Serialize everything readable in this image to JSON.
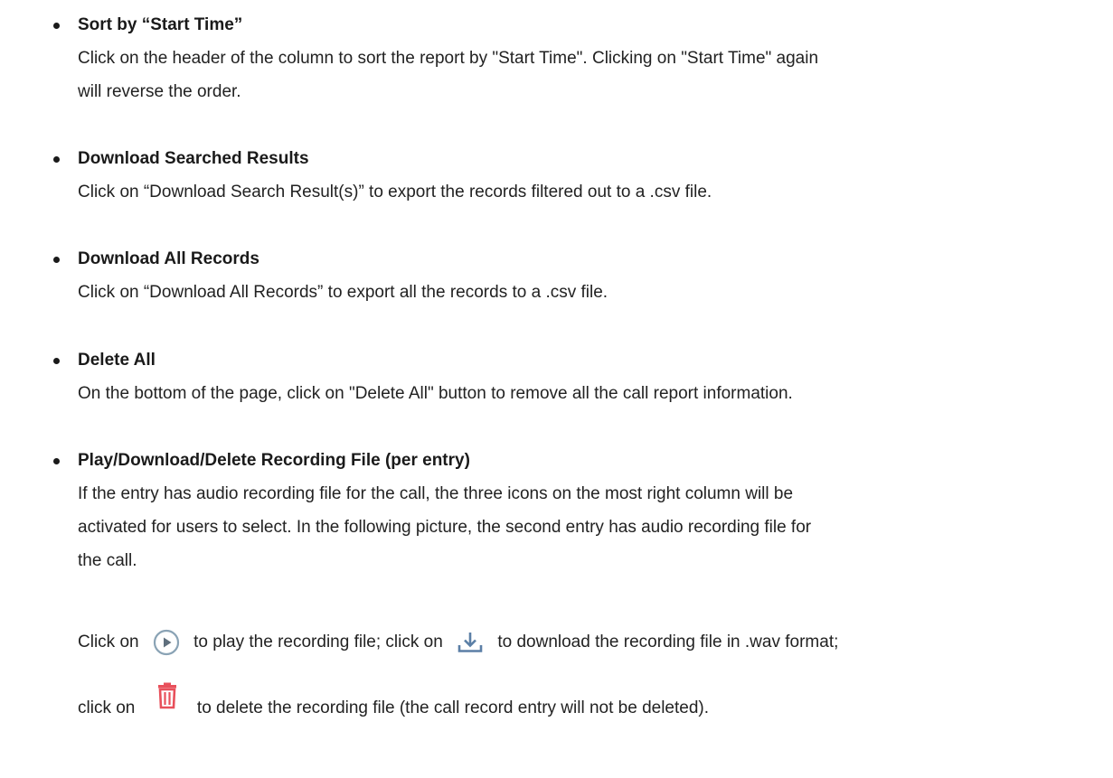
{
  "sections": [
    {
      "title": "Sort by “Start Time”",
      "lines": [
        "Click on the header of the column to sort the report by \"Start Time\". Clicking on \"Start Time\" again",
        "will reverse the order."
      ]
    },
    {
      "title": "Download Searched Results",
      "lines": [
        "Click on “Download Search Result(s)” to export the records filtered out to a .csv file."
      ]
    },
    {
      "title": "Download All Records",
      "lines": [
        "Click on “Download All Records” to export all the records to a .csv file."
      ]
    },
    {
      "title": "Delete All",
      "lines": [
        "On the bottom of the page, click on \"Delete All\" button to remove all the call report information."
      ]
    },
    {
      "title": "Play/Download/Delete Recording File (per entry)",
      "lines": [
        "If the entry has audio recording file for the call, the three icons on the most right column will be",
        "activated for users to select. In the following picture, the second entry has audio recording file for",
        "the call."
      ],
      "icon_sentence": {
        "line1": {
          "before_play": "Click on",
          "after_play": "to play the recording file; click on",
          "after_download": "to download the recording file in .wav format;"
        },
        "line2": {
          "before_delete": "click on",
          "after_delete": "to delete the recording file (the call record entry will not be deleted)."
        }
      }
    }
  ],
  "icons": {
    "play": "play-circle-icon",
    "download": "download-icon",
    "delete": "trash-icon"
  },
  "colors": {
    "text": "#1a1a1a",
    "play_icon": "#8aa3b5",
    "download_icon": "#5b7fa6",
    "delete_icon": "#e8505b"
  }
}
